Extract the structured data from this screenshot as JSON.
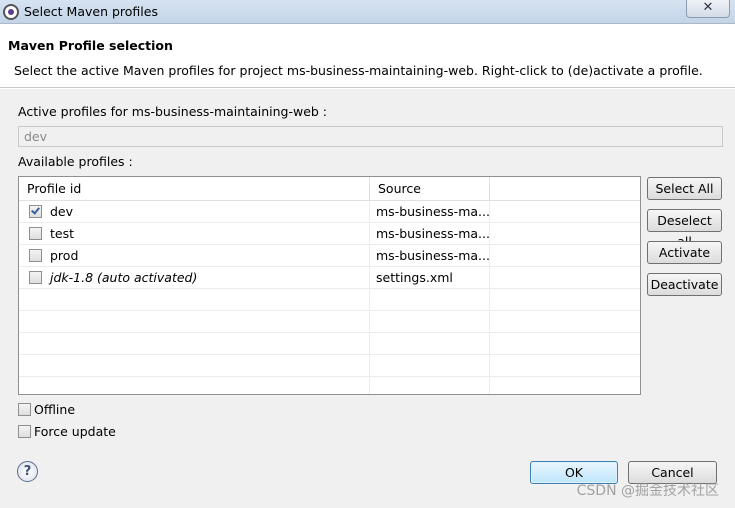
{
  "window": {
    "title": "Select Maven profiles",
    "close_symbol": "✕"
  },
  "header": {
    "title": "Maven Profile selection",
    "description": "Select the active Maven profiles for project ms-business-maintaining-web. Right-click to (de)activate a profile."
  },
  "active_profiles": {
    "label": "Active profiles for ms-business-maintaining-web :",
    "value": "dev"
  },
  "available": {
    "label": "Available profiles :",
    "columns": [
      "Profile id",
      "Source",
      ""
    ],
    "rows": [
      {
        "id": "dev",
        "source": "ms-business-ma...",
        "checked": true,
        "italic": false
      },
      {
        "id": "test",
        "source": "ms-business-ma...",
        "checked": false,
        "italic": false
      },
      {
        "id": "prod",
        "source": "ms-business-ma...",
        "checked": false,
        "italic": false
      },
      {
        "id": "jdk-1.8 (auto activated)",
        "source": "settings.xml",
        "checked": false,
        "italic": true
      }
    ],
    "empty_rows": 5
  },
  "side_buttons": {
    "select_all": "Select All",
    "deselect_all": "Deselect all",
    "activate": "Activate",
    "deactivate": "Deactivate"
  },
  "options": {
    "offline": {
      "label": "Offline",
      "checked": false
    },
    "force_update": {
      "label": "Force update",
      "checked": false
    }
  },
  "footer": {
    "help_symbol": "?",
    "ok": "OK",
    "cancel": "Cancel"
  },
  "watermark": "CSDN @掘金技术社区"
}
